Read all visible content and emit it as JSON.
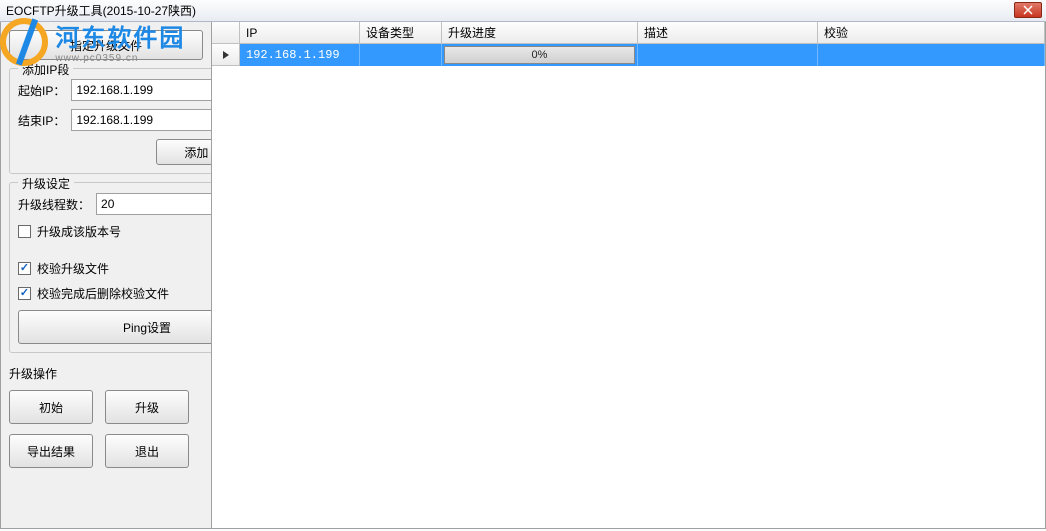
{
  "titlebar": {
    "title": "EOCFTP升级工具(2015-10-27陕西)"
  },
  "watermark": {
    "brand_cn": "河东软件园",
    "brand_url": "www.pc0359.cn"
  },
  "sidebar": {
    "select_file_btn": "指定升级文件",
    "ip_group": {
      "title": "添加IP段",
      "start_label": "起始IP：",
      "start_value": "192.168.1.199",
      "end_label": "结束IP：",
      "end_value": "192.168.1.199",
      "add_btn": "添加"
    },
    "upgrade_group": {
      "title": "升级设定",
      "threads_label": "升级线程数：",
      "threads_value": "20",
      "version_check": "升级成该版本号",
      "verify_file_check": "校验升级文件",
      "verify_delete_check": "校验完成后删除校验文件",
      "ping_btn": "Ping设置"
    },
    "action_group": {
      "title": "升级操作",
      "init_btn": "初始",
      "upgrade_btn": "升级",
      "export_btn": "导出结果",
      "exit_btn": "退出"
    }
  },
  "grid": {
    "headers": {
      "ip": "IP",
      "type": "设备类型",
      "progress": "升级进度",
      "desc": "描述",
      "verify": "校验"
    },
    "rows": [
      {
        "ip": "192.168.1.199",
        "type": "",
        "progress": "0%",
        "desc": "",
        "verify": ""
      }
    ]
  }
}
